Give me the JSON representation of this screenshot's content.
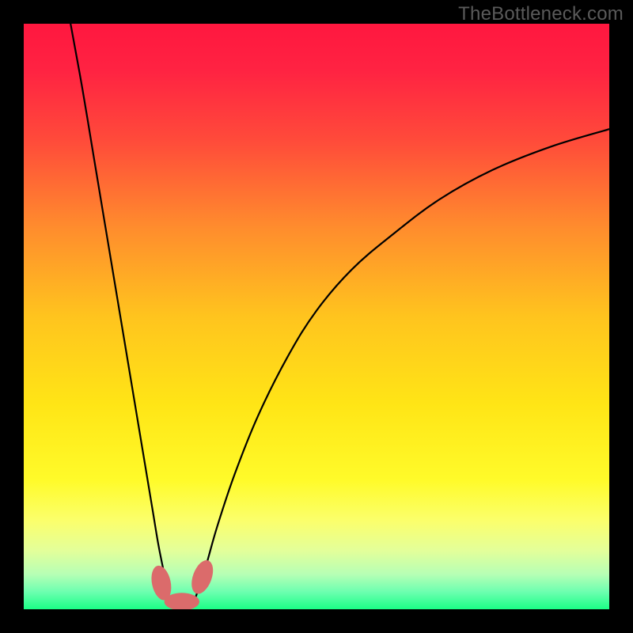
{
  "watermark": "TheBottleneck.com",
  "chart_data": {
    "type": "line",
    "title": "",
    "xlabel": "",
    "ylabel": "",
    "xlim": [
      0,
      100
    ],
    "ylim": [
      0,
      100
    ],
    "grid": false,
    "background_gradient": {
      "stops": [
        {
          "offset": 0.0,
          "color": "#ff173f"
        },
        {
          "offset": 0.08,
          "color": "#ff2342"
        },
        {
          "offset": 0.2,
          "color": "#ff4b3a"
        },
        {
          "offset": 0.35,
          "color": "#ff8d2d"
        },
        {
          "offset": 0.5,
          "color": "#ffc41e"
        },
        {
          "offset": 0.65,
          "color": "#ffe516"
        },
        {
          "offset": 0.78,
          "color": "#fffb2a"
        },
        {
          "offset": 0.85,
          "color": "#fbff6d"
        },
        {
          "offset": 0.9,
          "color": "#e3ff9a"
        },
        {
          "offset": 0.94,
          "color": "#b7ffb5"
        },
        {
          "offset": 0.97,
          "color": "#6dffb0"
        },
        {
          "offset": 1.0,
          "color": "#1bff86"
        }
      ]
    },
    "series": [
      {
        "name": "curve-left",
        "color": "#000000",
        "x": [
          8,
          10,
          12,
          14,
          16,
          18,
          20,
          21,
          22,
          23,
          24,
          25
        ],
        "y": [
          100,
          89,
          77,
          65,
          53,
          41,
          29,
          23,
          17,
          11,
          6,
          1
        ]
      },
      {
        "name": "curve-right",
        "color": "#000000",
        "x": [
          29,
          31,
          33,
          36,
          40,
          45,
          50,
          56,
          63,
          71,
          80,
          90,
          100
        ],
        "y": [
          1,
          7,
          14,
          23,
          33,
          43,
          51,
          58,
          64,
          70,
          75,
          79,
          82
        ]
      }
    ],
    "markers": [
      {
        "name": "marker-left",
        "x": 23.5,
        "y": 4.5,
        "rx": 1.6,
        "ry": 3.0,
        "angle": -12,
        "color": "#db6b6b"
      },
      {
        "name": "marker-right",
        "x": 30.5,
        "y": 5.5,
        "rx": 1.6,
        "ry": 3.0,
        "angle": 20,
        "color": "#db6b6b"
      },
      {
        "name": "marker-bottom",
        "x": 27.0,
        "y": 1.3,
        "rx": 3.0,
        "ry": 1.5,
        "angle": 0,
        "color": "#db6b6b"
      }
    ]
  }
}
